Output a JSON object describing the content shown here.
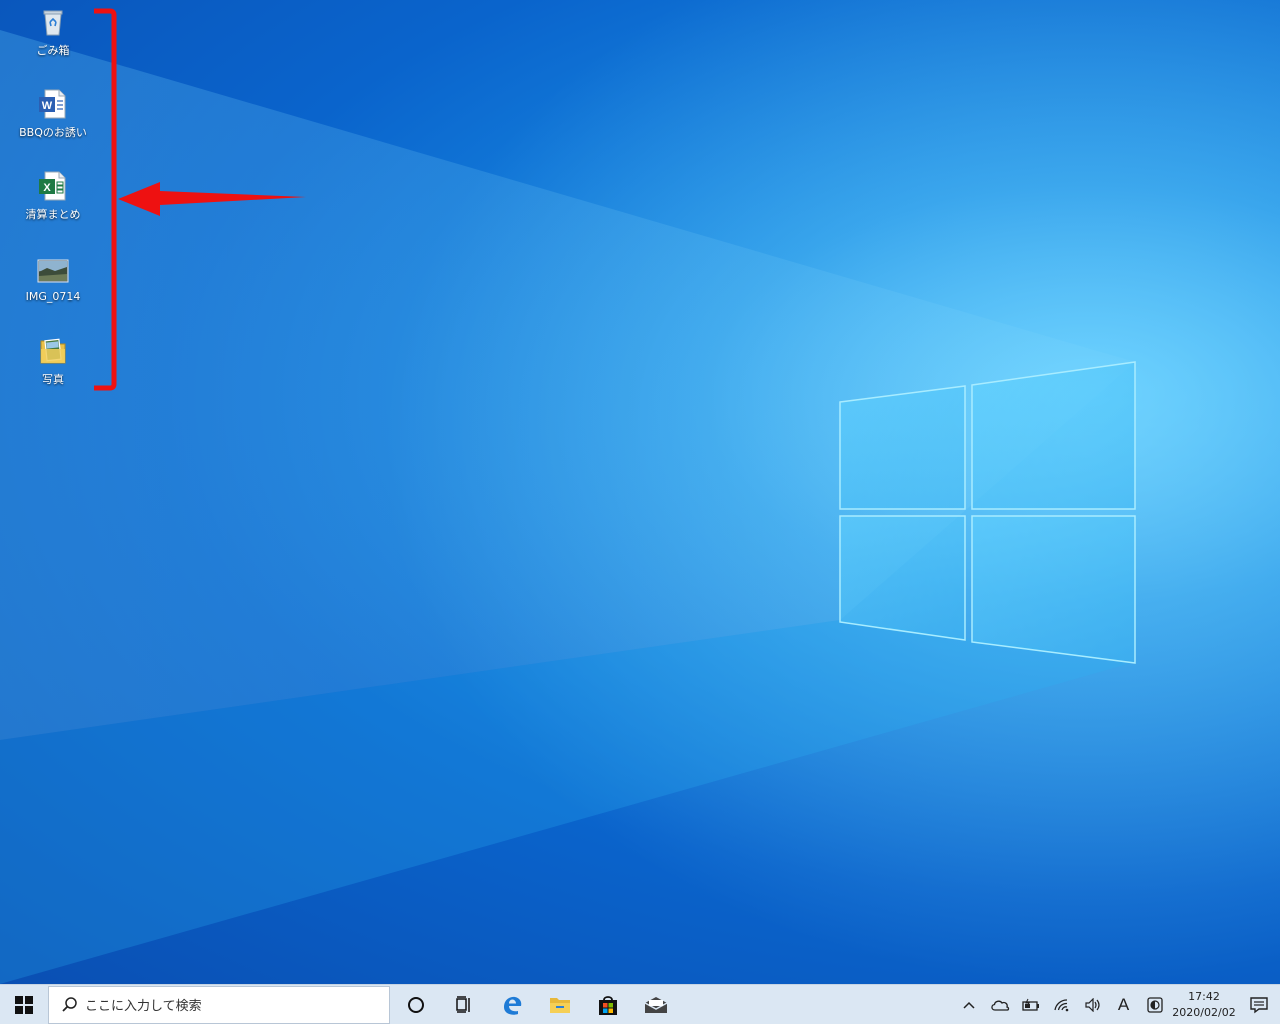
{
  "desktop": {
    "icons": [
      {
        "label": "ごみ箱",
        "icon": "recycle-bin-icon"
      },
      {
        "label": "BBQのお誘い",
        "icon": "word-document-icon"
      },
      {
        "label": "清算まとめ",
        "icon": "excel-document-icon"
      },
      {
        "label": "IMG_0714",
        "icon": "image-file-icon"
      },
      {
        "label": "写真",
        "icon": "photos-folder-icon"
      }
    ],
    "annotation": {
      "color": "#ee1111"
    }
  },
  "taskbar": {
    "search_placeholder": "ここに入力して検索",
    "pinned": [
      "cortana-icon",
      "task-view-icon",
      "edge-icon",
      "file-explorer-icon",
      "store-icon",
      "mail-icon"
    ],
    "tray": {
      "ime_label": "A",
      "time": "17:42",
      "date": "2020/02/02"
    }
  },
  "colors": {
    "taskbar_bg": "#dbe7f3",
    "desktop_accent": "#1a8fe6"
  }
}
